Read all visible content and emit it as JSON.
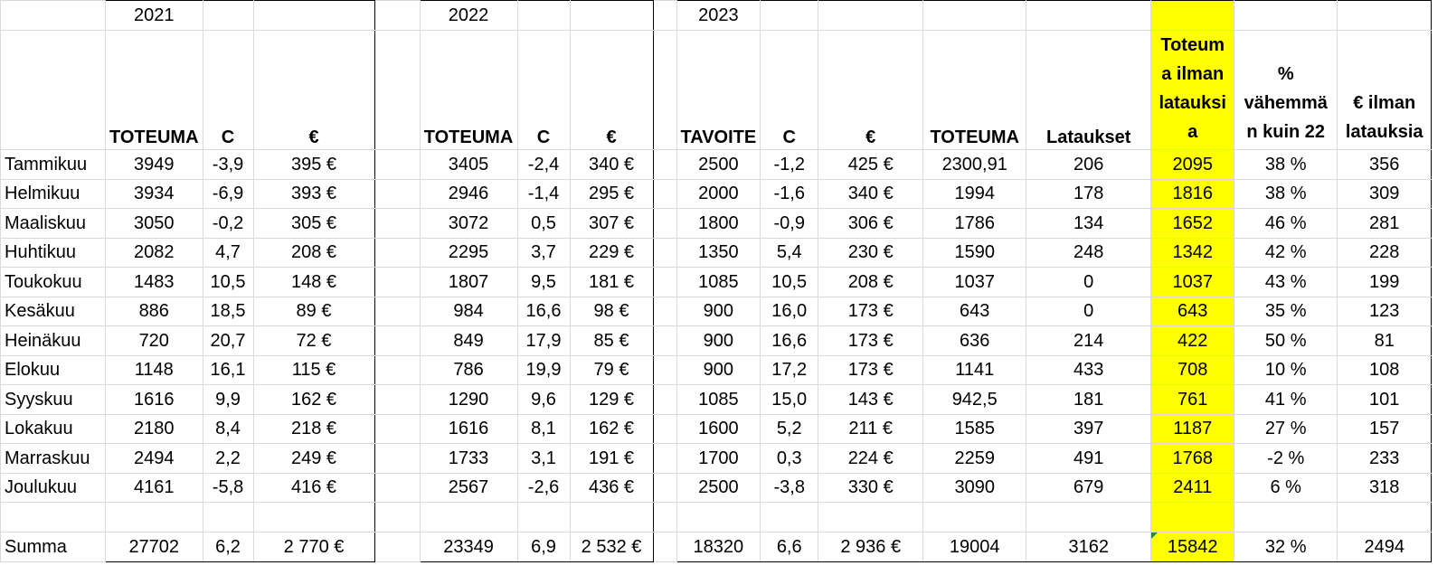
{
  "years": [
    "2021",
    "2022",
    "2023"
  ],
  "headers": {
    "y2021": [
      "TOTEUMA",
      "C",
      "€"
    ],
    "y2022": [
      "TOTEUMA",
      "C",
      "€"
    ],
    "y2023": [
      "TAVOITE",
      "C",
      "€",
      "TOTEUMA",
      "Lataukset",
      "Toteum a ilman latauksi a",
      "% vähemmä n kuin 22",
      "€ ilman latauksia"
    ]
  },
  "rows": [
    {
      "month": "Tammikuu",
      "y2021": [
        "3949",
        "-3,9",
        "395 €"
      ],
      "y2022": [
        "3405",
        "-2,4",
        "340 €"
      ],
      "y2023": [
        "2500",
        "-1,2",
        "425 €",
        "2300,91",
        "206",
        "2095",
        "38 %",
        "356"
      ]
    },
    {
      "month": "Helmikuu",
      "y2021": [
        "3934",
        "-6,9",
        "393 €"
      ],
      "y2022": [
        "2946",
        "-1,4",
        "295 €"
      ],
      "y2023": [
        "2000",
        "-1,6",
        "340 €",
        "1994",
        "178",
        "1816",
        "38 %",
        "309"
      ]
    },
    {
      "month": "Maaliskuu",
      "y2021": [
        "3050",
        "-0,2",
        "305 €"
      ],
      "y2022": [
        "3072",
        "0,5",
        "307 €"
      ],
      "y2023": [
        "1800",
        "-0,9",
        "306 €",
        "1786",
        "134",
        "1652",
        "46 %",
        "281"
      ]
    },
    {
      "month": "Huhtikuu",
      "y2021": [
        "2082",
        "4,7",
        "208 €"
      ],
      "y2022": [
        "2295",
        "3,7",
        "229 €"
      ],
      "y2023": [
        "1350",
        "5,4",
        "230 €",
        "1590",
        "248",
        "1342",
        "42 %",
        "228"
      ]
    },
    {
      "month": "Toukokuu",
      "y2021": [
        "1483",
        "10,5",
        "148 €"
      ],
      "y2022": [
        "1807",
        "9,5",
        "181 €"
      ],
      "y2023": [
        "1085",
        "10,5",
        "208 €",
        "1037",
        "0",
        "1037",
        "43 %",
        "199"
      ]
    },
    {
      "month": "Kesäkuu",
      "y2021": [
        "886",
        "18,5",
        "89 €"
      ],
      "y2022": [
        "984",
        "16,6",
        "98 €"
      ],
      "y2023": [
        "900",
        "16,0",
        "173 €",
        "643",
        "0",
        "643",
        "35 %",
        "123"
      ]
    },
    {
      "month": "Heinäkuu",
      "y2021": [
        "720",
        "20,7",
        "72 €"
      ],
      "y2022": [
        "849",
        "17,9",
        "85 €"
      ],
      "y2023": [
        "900",
        "16,6",
        "173 €",
        "636",
        "214",
        "422",
        "50 %",
        "81"
      ]
    },
    {
      "month": "Elokuu",
      "y2021": [
        "1148",
        "16,1",
        "115 €"
      ],
      "y2022": [
        "786",
        "19,9",
        "79 €"
      ],
      "y2023": [
        "900",
        "17,2",
        "173 €",
        "1141",
        "433",
        "708",
        "10 %",
        "108"
      ]
    },
    {
      "month": "Syyskuu",
      "y2021": [
        "1616",
        "9,9",
        "162 €"
      ],
      "y2022": [
        "1290",
        "9,6",
        "129 €"
      ],
      "y2023": [
        "1085",
        "15,0",
        "143 €",
        "942,5",
        "181",
        "761",
        "41 %",
        "101"
      ]
    },
    {
      "month": "Lokakuu",
      "y2021": [
        "2180",
        "8,4",
        "218 €"
      ],
      "y2022": [
        "1616",
        "8,1",
        "162 €"
      ],
      "y2023": [
        "1600",
        "5,2",
        "211 €",
        "1585",
        "397",
        "1187",
        "27 %",
        "157"
      ]
    },
    {
      "month": "Marraskuu",
      "y2021": [
        "2494",
        "2,2",
        "249 €"
      ],
      "y2022": [
        "1733",
        "3,1",
        "191 €"
      ],
      "y2023": [
        "1700",
        "0,3",
        "224 €",
        "2259",
        "491",
        "1768",
        "-2 %",
        "233"
      ]
    },
    {
      "month": "Joulukuu",
      "y2021": [
        "4161",
        "-5,8",
        "416 €"
      ],
      "y2022": [
        "2567",
        "-2,6",
        "436 €"
      ],
      "y2023": [
        "2500",
        "-3,8",
        "330 €",
        "3090",
        "679",
        "2411",
        "6 %",
        "318"
      ]
    }
  ],
  "total": {
    "month": "Summa",
    "y2021": [
      "27702",
      "6,2",
      "2 770 €"
    ],
    "y2022": [
      "23349",
      "6,9",
      "2 532 €"
    ],
    "y2023": [
      "18320",
      "6,6",
      "2 936 €",
      "19004",
      "3162",
      "15842",
      "32 %",
      "2494"
    ]
  },
  "colors": {
    "highlight": "#ffff00",
    "grid": "#d9d9d9",
    "border": "#000000",
    "error_marker": "#1e8a3a"
  }
}
